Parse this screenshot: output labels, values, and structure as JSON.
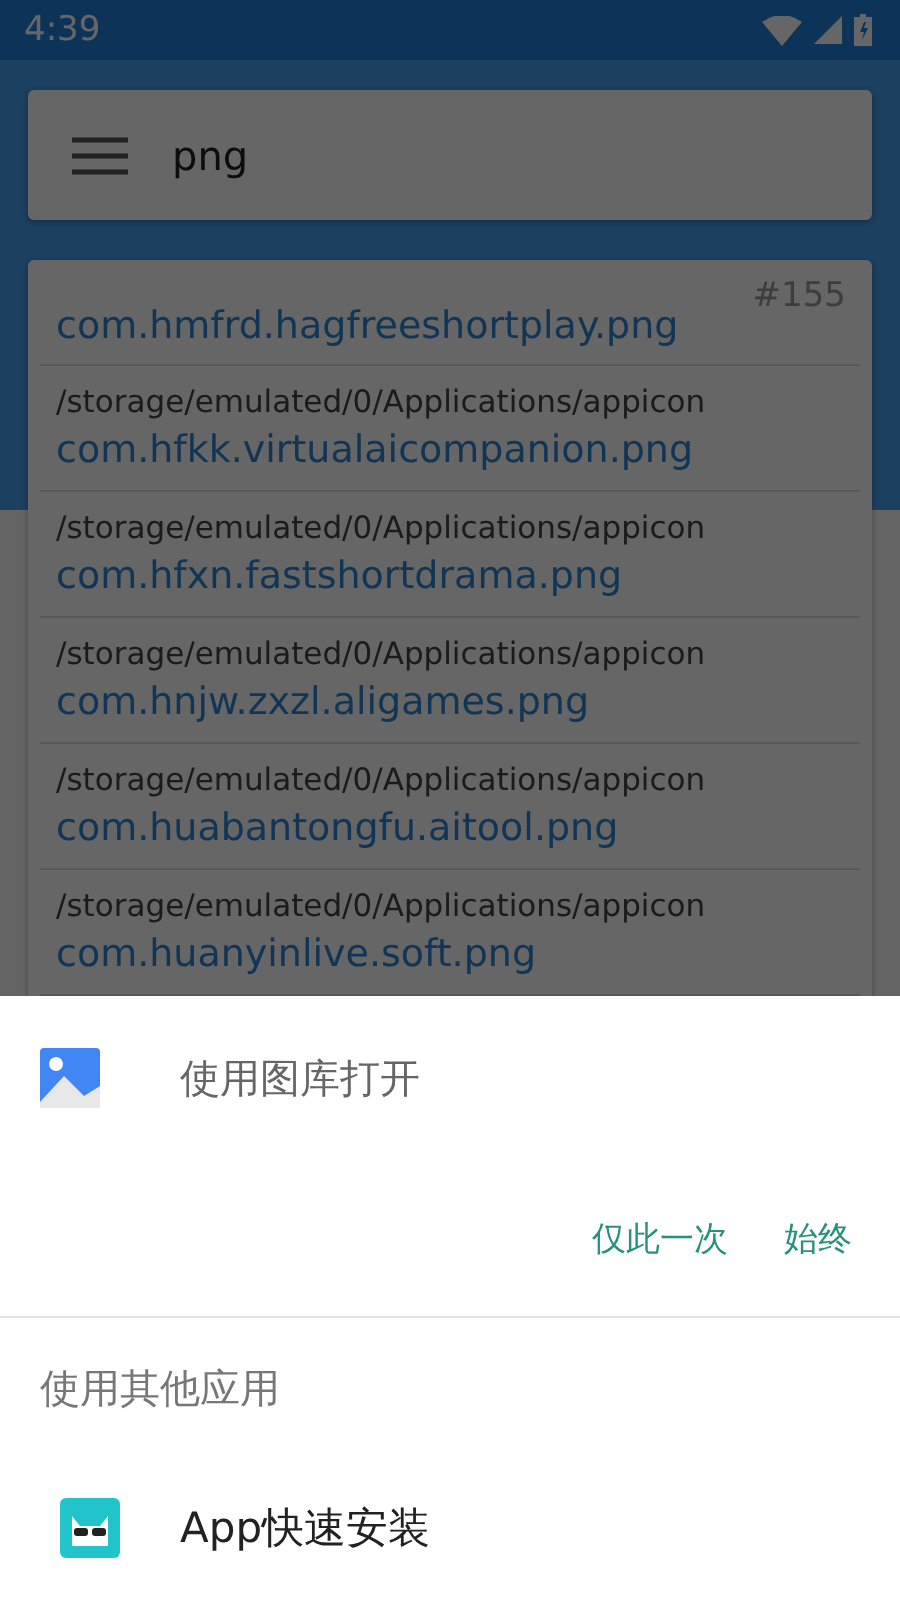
{
  "status_bar": {
    "time": "4:39"
  },
  "search": {
    "value": "png"
  },
  "results": {
    "count": "#155",
    "items": [
      {
        "kind": "cut",
        "name": "com.hmfrd.hagfreeshortplay.png"
      },
      {
        "kind": "full",
        "path": "/storage/emulated/0/Applications/appicon",
        "name": "com.hfkk.virtualaicompanion.png"
      },
      {
        "kind": "full",
        "path": "/storage/emulated/0/Applications/appicon",
        "name": "com.hfxn.fastshortdrama.png"
      },
      {
        "kind": "full",
        "path": "/storage/emulated/0/Applications/appicon",
        "name": "com.hnjw.zxzl.aligames.png"
      },
      {
        "kind": "full",
        "path": "/storage/emulated/0/Applications/appicon",
        "name": "com.huabantongfu.aitool.png"
      },
      {
        "kind": "full",
        "path": "/storage/emulated/0/Applications/appicon",
        "name": "com.huanyinlive.soft.png"
      }
    ]
  },
  "chooser": {
    "default_app": "使用图库打开",
    "actions": [
      "仅此一次",
      "始终"
    ],
    "other_heading": "使用其他应用",
    "apps": [
      {
        "label": "App快速安装"
      }
    ]
  }
}
